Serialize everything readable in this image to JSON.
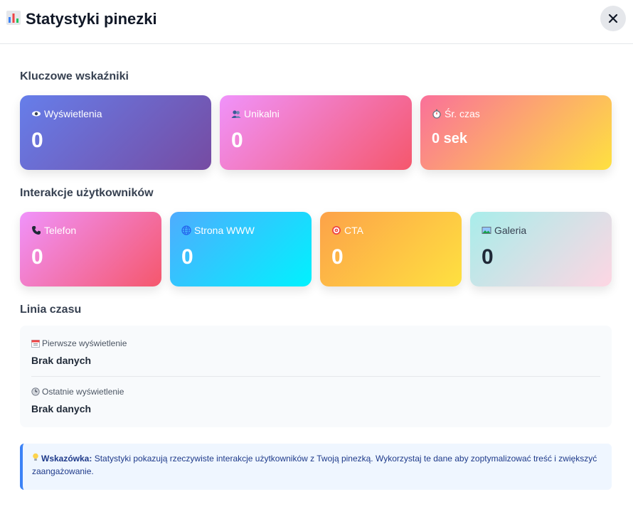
{
  "header": {
    "title": "Statystyki pinezki",
    "icon": "bar-chart-icon",
    "close_icon": "close-icon"
  },
  "key_metrics": {
    "title": "Kluczowe wskaźniki",
    "cards": [
      {
        "icon": "eye-icon",
        "label": "Wyświetlenia",
        "value": "0",
        "gradient": [
          "#667eea",
          "#764ba2"
        ]
      },
      {
        "icon": "users-icon",
        "label": "Unikalni",
        "value": "0",
        "gradient": [
          "#f093fb",
          "#f5576c"
        ]
      },
      {
        "icon": "stopwatch-icon",
        "label": "Śr. czas",
        "value": "0 sek",
        "gradient": [
          "#fa709a",
          "#fee140"
        ]
      }
    ]
  },
  "interactions": {
    "title": "Interakcje użytkowników",
    "cards": [
      {
        "icon": "phone-icon",
        "label": "Telefon",
        "value": "0",
        "gradient": [
          "#f093fb",
          "#f5576c"
        ]
      },
      {
        "icon": "globe-icon",
        "label": "Strona WWW",
        "value": "0",
        "gradient": [
          "#4facfe",
          "#00f2fe"
        ]
      },
      {
        "icon": "target-icon",
        "label": "CTA",
        "value": "0",
        "gradient": [
          "#fda249",
          "#fee140"
        ]
      },
      {
        "icon": "picture-icon",
        "label": "Galeria",
        "value": "0",
        "gradient": [
          "#a8edea",
          "#fed6e3"
        ]
      }
    ]
  },
  "timeline": {
    "title": "Linia czasu",
    "first": {
      "icon": "calendar-icon",
      "label": "Pierwsze wyświetlenie",
      "value": "Brak danych"
    },
    "last": {
      "icon": "clock-icon",
      "label": "Ostatnie wyświetlenie",
      "value": "Brak danych"
    }
  },
  "tip": {
    "icon": "lightbulb-icon",
    "label": "Wskazówka:",
    "text": "Statystyki pokazują rzeczywiste interakcje użytkowników z Twoją pinezką. Wykorzystaj te dane aby zoptymalizować treść i zwiększyć zaangażowanie."
  },
  "colors": {
    "accent": "#3b82f6",
    "tip_bg": "#eff6ff",
    "tip_text": "#1e3a8a"
  }
}
